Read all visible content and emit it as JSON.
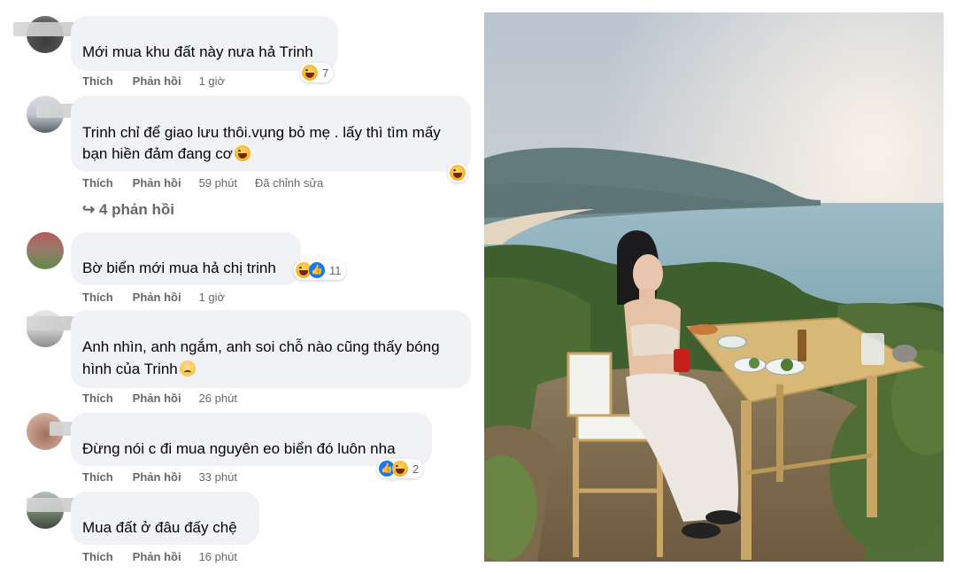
{
  "actions": {
    "like": "Thích",
    "reply": "Phản hồi"
  },
  "comments": [
    {
      "text": "Mới mua khu đất này nưa hả Trinh",
      "time": "1 giờ",
      "reaction_count": "7",
      "edited": ""
    },
    {
      "text_line1": "Trinh chỉ để giao lưu thôi.vụng bỏ mẹ . lấy thì tìm mấy",
      "text_line2": "bạn hiền đảm đang cơ",
      "time": "59 phút",
      "edited": "Đã chỉnh sửa",
      "replies": "4 phản hồi"
    },
    {
      "text": "Bờ biển mới mua hả chị trinh",
      "time": "1 giờ",
      "reaction_count": "11"
    },
    {
      "text_line1": "Anh nhìn, anh ngắm, anh soi chỗ nào cũng thấy bóng",
      "text_line2": "hình của Trinh",
      "time": "26 phút"
    },
    {
      "text": "Đừng nói c đi mua nguyên eo biển đó luôn nha",
      "time": "33 phút",
      "reaction_count": "2"
    },
    {
      "text": "Mua đất ở đâu đấy chệ",
      "time": "16 phút"
    }
  ],
  "colors": {
    "bubble": "#f0f2f5",
    "meta": "#65676b",
    "text": "#050505",
    "like": "#1877f2"
  },
  "icons": {
    "reply_arrow": "reply-arrow-icon",
    "haha": "haha-reaction-icon",
    "like": "like-reaction-icon",
    "sad": "sad-emoji-icon"
  }
}
